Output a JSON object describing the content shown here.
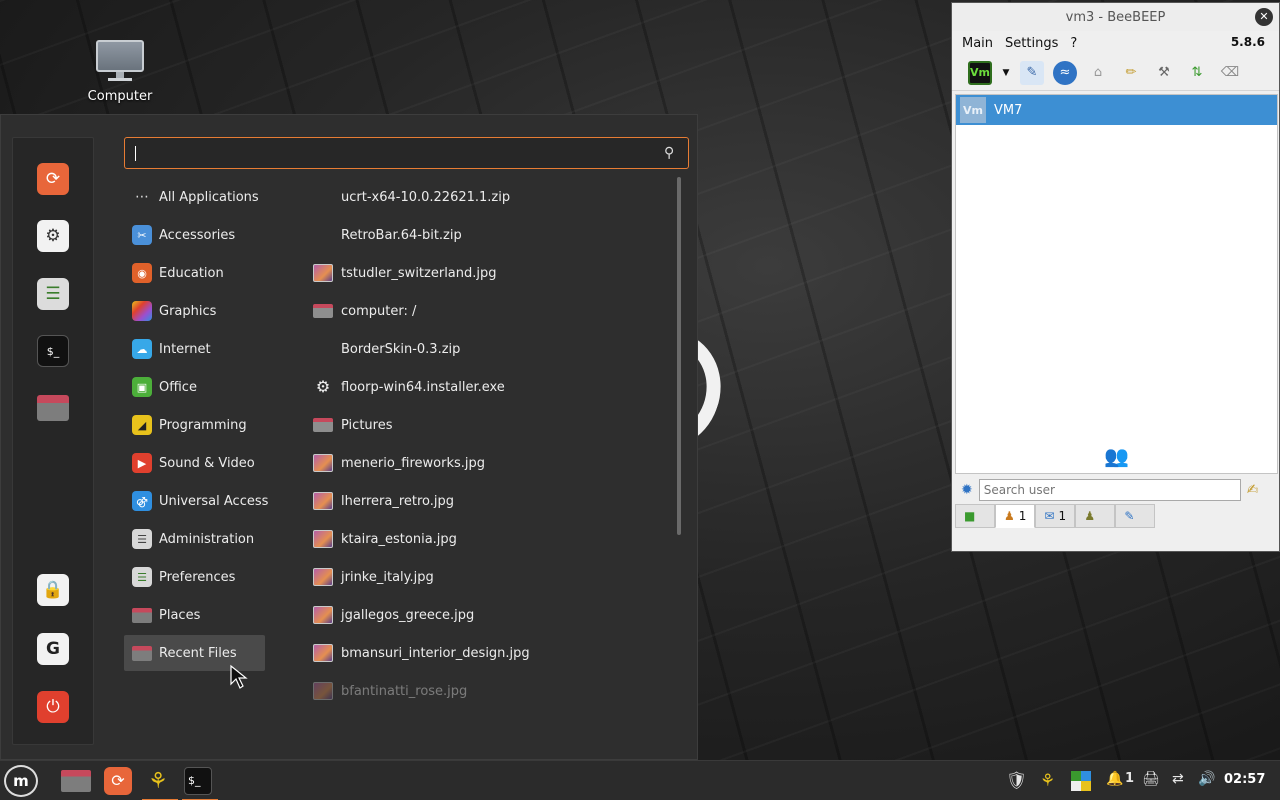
{
  "desktop": {
    "icons": [
      {
        "label": "Computer",
        "icon": "computer-icon"
      }
    ]
  },
  "menu": {
    "search": {
      "value": "",
      "placeholder": ""
    },
    "favorites": [
      "firefox-icon",
      "settings-icon",
      "control-panel-icon",
      "terminal-icon",
      "folder-icon"
    ],
    "session": [
      "lock-icon",
      "logout-icon",
      "power-icon"
    ],
    "categories": [
      {
        "label": "All Applications",
        "icon": "grid-icon",
        "color": "#2e2e2e"
      },
      {
        "label": "Accessories",
        "icon": "scissors-icon",
        "color": "#4a90d9"
      },
      {
        "label": "Education",
        "icon": "education-icon",
        "color": "#e0612a"
      },
      {
        "label": "Graphics",
        "icon": "graphics-icon",
        "color": "#9b4fd0"
      },
      {
        "label": "Internet",
        "icon": "cloud-icon",
        "color": "#37a8e8"
      },
      {
        "label": "Office",
        "icon": "office-icon",
        "color": "#4caf3a"
      },
      {
        "label": "Programming",
        "icon": "programming-icon",
        "color": "#e8c21c"
      },
      {
        "label": "Sound & Video",
        "icon": "play-icon",
        "color": "#e0402e"
      },
      {
        "label": "Universal Access",
        "icon": "accessibility-icon",
        "color": "#2f8fe0"
      },
      {
        "label": "Administration",
        "icon": "admin-icon",
        "color": "#d8d8d8"
      },
      {
        "label": "Preferences",
        "icon": "preferences-icon",
        "color": "#8a8a8a"
      },
      {
        "label": "Places",
        "icon": "places-folder-icon",
        "color": "#777777"
      },
      {
        "label": "Recent Files",
        "icon": "recent-folder-icon",
        "color": "#777777"
      }
    ],
    "active_category": "Recent Files",
    "files": [
      {
        "label": "ucrt-x64-10.0.22621.1.zip",
        "type": "none"
      },
      {
        "label": "RetroBar.64-bit.zip",
        "type": "none"
      },
      {
        "label": "tstudler_switzerland.jpg",
        "type": "img"
      },
      {
        "label": "computer: /",
        "type": "folder"
      },
      {
        "label": "BorderSkin-0.3.zip",
        "type": "none"
      },
      {
        "label": "floorp-win64.installer.exe",
        "type": "gear"
      },
      {
        "label": "Pictures",
        "type": "folder"
      },
      {
        "label": "menerio_fireworks.jpg",
        "type": "img"
      },
      {
        "label": "lherrera_retro.jpg",
        "type": "img"
      },
      {
        "label": "ktaira_estonia.jpg",
        "type": "img"
      },
      {
        "label": "jrinke_italy.jpg",
        "type": "img"
      },
      {
        "label": "jgallegos_greece.jpg",
        "type": "img"
      },
      {
        "label": "bmansuri_interior_design.jpg",
        "type": "img"
      },
      {
        "label": "bfantinatti_rose.jpg",
        "type": "img"
      }
    ]
  },
  "beebeep": {
    "title": "vm3 - BeeBEEP",
    "menu": [
      "Main",
      "Settings",
      "?"
    ],
    "version": "5.8.6",
    "user": {
      "avatar": "Vm",
      "name": "VM7"
    },
    "search_placeholder": "Search user",
    "tabs": [
      {
        "icon": "chip-icon",
        "count": ""
      },
      {
        "icon": "users-icon",
        "count": "1"
      },
      {
        "icon": "chat-icon",
        "count": "1"
      },
      {
        "icon": "groups-icon",
        "count": ""
      },
      {
        "icon": "files-icon",
        "count": ""
      }
    ]
  },
  "taskbar": {
    "clock": "02:57",
    "notification_count": "1"
  }
}
